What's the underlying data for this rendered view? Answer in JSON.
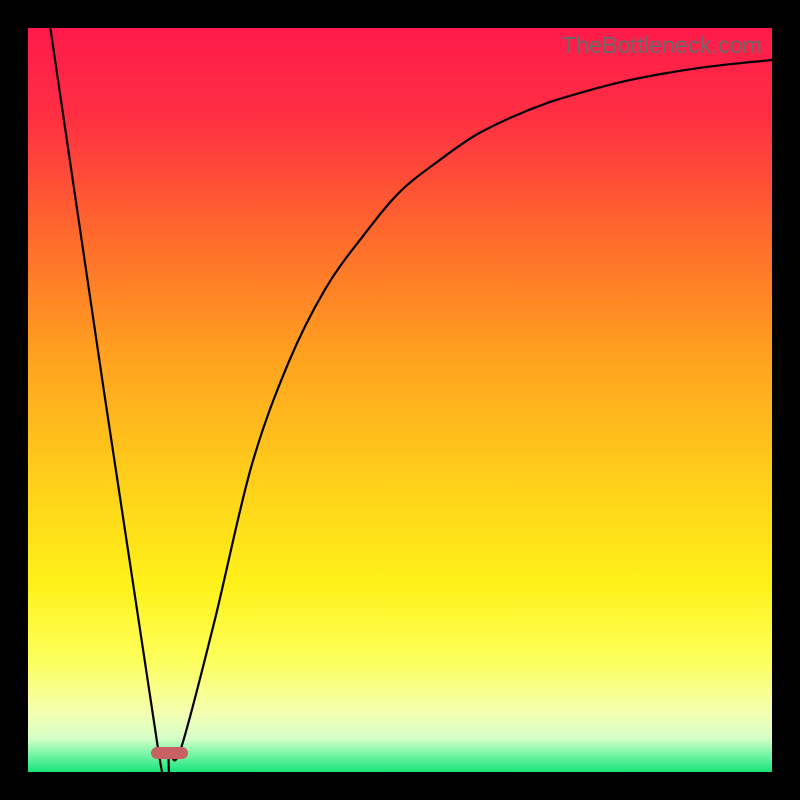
{
  "watermark": "TheBottleneck.com",
  "chart_data": {
    "type": "line",
    "title": "",
    "xlabel": "",
    "ylabel": "",
    "xlim": [
      0,
      100
    ],
    "ylim": [
      0,
      100
    ],
    "grid": false,
    "legend": false,
    "gradient_stops": [
      {
        "pos": 0.0,
        "color": "#ff1a4b"
      },
      {
        "pos": 0.12,
        "color": "#ff2f43"
      },
      {
        "pos": 0.28,
        "color": "#ff6a2c"
      },
      {
        "pos": 0.45,
        "color": "#ffa41f"
      },
      {
        "pos": 0.62,
        "color": "#ffd21a"
      },
      {
        "pos": 0.75,
        "color": "#fff21a"
      },
      {
        "pos": 0.85,
        "color": "#fdff5c"
      },
      {
        "pos": 0.92,
        "color": "#f4ffb0"
      },
      {
        "pos": 0.955,
        "color": "#d6ffc8"
      },
      {
        "pos": 0.975,
        "color": "#7cf7a8"
      },
      {
        "pos": 1.0,
        "color": "#18e47a"
      }
    ],
    "series": [
      {
        "name": "bottleneck-curve",
        "x": [
          3,
          17.5,
          19,
          20.5,
          25,
          30,
          35,
          40,
          45,
          50,
          55,
          60,
          65,
          70,
          75,
          80,
          85,
          90,
          95,
          100
        ],
        "y": [
          100,
          3,
          2.5,
          3,
          20,
          41,
          55,
          65,
          72,
          78,
          82,
          85.5,
          88,
          90,
          91.5,
          92.8,
          93.8,
          94.6,
          95.2,
          95.7
        ]
      }
    ],
    "marker": {
      "x": 19,
      "y": 2.6,
      "w": 5.0,
      "h": 1.6,
      "color": "#c76162"
    }
  }
}
